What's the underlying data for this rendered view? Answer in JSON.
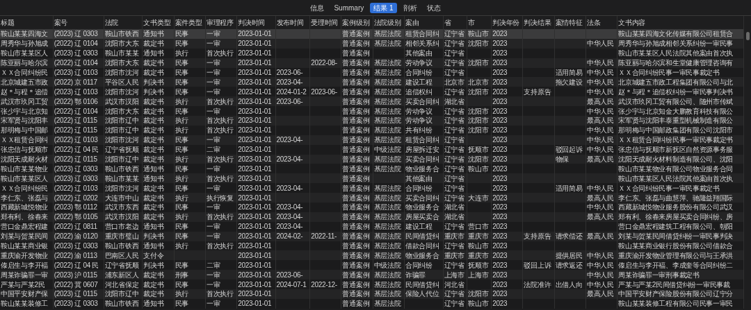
{
  "tabs": [
    {
      "label": "信息",
      "selected": false
    },
    {
      "label": "Summary",
      "selected": false
    },
    {
      "label": "结果 1",
      "selected": true
    },
    {
      "label": "剖析",
      "selected": false
    },
    {
      "label": "状态",
      "selected": false
    }
  ],
  "table": {
    "columns": [
      "标题",
      "案号",
      "法院",
      "文书类型",
      "案件类型",
      "审理程序",
      "判决时间",
      "发布时间",
      "受理时间",
      "案例级别",
      "法院级别",
      "案由",
      "省",
      "市",
      "判决年份",
      "判决结果",
      "案情特征",
      "法条",
      "文书内容"
    ],
    "rows": [
      {
        "selected": true,
        "cells": [
          "鞍山某某四海文",
          "(2023) 辽 0303",
          "鞍山市铁西",
          "通知书",
          "民事",
          "一审",
          "2023-01-01",
          null,
          null,
          "普通案例",
          "基层法院",
          "租赁合同纠",
          "辽宁省",
          "鞍山市",
          "2023",
          null,
          null,
          null,
          "鞍山某某四海文化传媒有限公司租赁合"
        ]
      },
      {
        "selected": false,
        "cells": [
          "周秀华与孙旭成",
          "(2022) 辽 0104",
          "沈阳市大东",
          "裁定书",
          "民事",
          "一审",
          "2023-01-01",
          null,
          null,
          "普通案例",
          "基层法院",
          "相邻关系纠",
          "辽宁省",
          "沈阳市",
          "2023",
          null,
          null,
          "中华人民",
          "周秀华与孙旭成相邻关系纠纷一审民事"
        ]
      },
      {
        "selected": false,
        "cells": [
          "鞍山市某某区人",
          "(2023) 辽 0303",
          "鞍山市某某",
          "通知书",
          "执行",
          "首次执行",
          "2023-01-01",
          null,
          null,
          "普通案例",
          null,
          "其他案由",
          "辽宁省",
          null,
          "2023",
          null,
          null,
          null,
          "鞍山市某某区人民法院其他案由首次执"
        ]
      },
      {
        "selected": false,
        "cells": [
          "陈亚丽与哈尔滨",
          "(2022) 辽 0104",
          "沈阳市大东",
          "裁定书",
          "民事",
          "一审",
          "2023-01-01",
          null,
          "2022-08-",
          "普通案例",
          "基层法院",
          "劳动争议",
          "辽宁省",
          "沈阳市",
          "2023",
          null,
          null,
          "中华人民",
          "陈亚丽与哈尔滨和生堂健康管理咨询有"
        ]
      },
      {
        "selected": false,
        "cells": [
          "ＸＸ合同纠纷民",
          "(2023) 辽 0103",
          "沈阳市沈河",
          "裁定书",
          "民事",
          "一审",
          "2023-01-01",
          "2023-06-",
          null,
          "普通案例",
          "基层法院",
          "合同纠纷",
          "辽宁省",
          null,
          "2023",
          null,
          "适用简易",
          "中华人民",
          "ＸＸ合同纠纷民事一审民事裁定书"
        ]
      },
      {
        "selected": false,
        "cells": [
          "北京城建五市政",
          "(2022) 京 0117",
          "平谷区人民",
          "判决书",
          "民事",
          "一审",
          "2023-01-01",
          "2023-04-",
          null,
          "普通案例",
          "基层法院",
          "建设工程",
          "北京市",
          "北京市",
          "2023",
          null,
          "拖欠建设",
          "中华人民",
          "北京城建五市政工程集团有限公司与北"
        ]
      },
      {
        "selected": false,
        "cells": [
          "赵＊与程＊追偿",
          "(2023) 辽 0103",
          "沈阳市沈河",
          "判决书",
          "民事",
          "一审",
          "2023-01-01",
          "2024-01-2",
          "2023-06-",
          "普通案例",
          "基层法院",
          "追偿权纠",
          "辽宁省",
          "沈阳市",
          "2023",
          "支持原告",
          null,
          "中华人民",
          "赵＊与程＊追偿权纠纷一审民事判决书"
        ]
      },
      {
        "selected": false,
        "cells": [
          "武汉市玖冈工贸",
          "(2022) 鄂 0106",
          "武汉市汉阳",
          "裁定书",
          "执行",
          "首次执行",
          "2023-01-01",
          "2023-06-",
          null,
          "普通案例",
          "基层法院",
          "买卖合同纠",
          "湖北省",
          null,
          "2023",
          null,
          null,
          "最高人民",
          "武汉市玖冈工贸有限公司、随州市传斌"
        ]
      },
      {
        "selected": false,
        "cells": [
          "张少宇与北京知",
          "(2022) 辽 0104",
          "沈阳市大东",
          "裁定书",
          "民事",
          "一审",
          "2023-01-01",
          null,
          null,
          "普通案例",
          "基层法院",
          "劳动争议",
          "辽宁省",
          "沈阳市",
          "2023",
          null,
          null,
          "中华人民",
          "张少宇与北京知金大鹏教育科技有限公"
        ]
      },
      {
        "selected": false,
        "cells": [
          "宋军贤与沈阳丰",
          "(2022) 辽 0115",
          "沈阳市辽中",
          "裁定书",
          "执行",
          "首次执行",
          "2023-01-01",
          null,
          null,
          "普通案例",
          "基层法院",
          "劳动争议",
          "辽宁省",
          "沈阳市",
          "2023",
          null,
          null,
          "最高人民",
          "宋军贤与沈阳丰泰重型机械制造有限公"
        ]
      },
      {
        "selected": false,
        "cells": [
          "那明梅与中国邮",
          "(2022) 辽 0115",
          "沈阳市辽中",
          "裁定书",
          "执行",
          "首次执行",
          "2023-01-01",
          null,
          null,
          "普通案例",
          "基层法院",
          "共有纠纷",
          "辽宁省",
          "沈阳市",
          "2023",
          null,
          null,
          "中华人民",
          "那明梅与中国邮政集团有限公司沈阳市"
        ]
      },
      {
        "selected": false,
        "cells": [
          "ＸＸ租赁合同纠",
          "(2022) 辽 0103",
          "沈阳市沈河",
          "裁定书",
          "民事",
          "一审",
          "2023-01-01",
          "2023-04-",
          null,
          "普通案例",
          "基层法院",
          "租赁合同纠",
          "辽宁省",
          null,
          "2023",
          null,
          null,
          "中华人民",
          "ＸＸ租赁合同纠纷民事一审民事裁定书"
        ]
      },
      {
        "selected": false,
        "cells": [
          "张忠信与抚顺市",
          "(2022) 辽 04 民",
          "辽宁省抚顺",
          "裁定书",
          "民事",
          "二审",
          "2023-01-01",
          null,
          null,
          "普通案例",
          "中级法院",
          "房屋拆迁安",
          "辽宁省",
          "抚顺市",
          "2023",
          null,
          "驳回起诉",
          "中华人民",
          "张忠信与抚顺市新抚区自然资源事务服"
        ]
      },
      {
        "selected": false,
        "cells": [
          "沈阳天成耐火材",
          "(2022) 辽 0115",
          "沈阳市辽中",
          "裁定书",
          "执行",
          "首次执行",
          "2023-01-01",
          "2023-04-",
          null,
          "普通案例",
          "基层法院",
          "买卖合同纠",
          "辽宁省",
          "沈阳市",
          "2023",
          null,
          "物保",
          "最高人民",
          "沈阳天成耐火材料制造有限公司、沈阳"
        ]
      },
      {
        "selected": false,
        "cells": [
          "鞍山市某某物业",
          "(2023) 辽 0303",
          "鞍山市铁西",
          "通知书",
          "民事",
          "一审",
          "2023-01-01",
          null,
          null,
          "普通案例",
          "基层法院",
          "物业服务合",
          "辽宁省",
          "鞍山市",
          "2023",
          null,
          null,
          null,
          "鞍山市某某物业有限公司物业服务合同"
        ]
      },
      {
        "selected": false,
        "cells": [
          "鞍山市某某区人",
          "(2023) 辽 0303",
          "鞍山市某某",
          "通知书",
          "执行",
          "首次执行",
          "2023-01-01",
          null,
          null,
          "普通案例",
          null,
          "其他案由",
          "辽宁省",
          null,
          "2023",
          null,
          null,
          null,
          "鞍山市某某区人民法院其他案由首次执"
        ]
      },
      {
        "selected": false,
        "cells": [
          "ＸＸ合同纠纷民",
          "(2022) 辽 0103",
          "沈阳市沈河",
          "裁定书",
          "民事",
          "一审",
          "2023-01-01",
          "2023-04-",
          null,
          "普通案例",
          "基层法院",
          "合同纠纷",
          "辽宁省",
          null,
          "2023",
          null,
          "适用简易",
          "中华人民",
          "ＸＸ合同纠纷民事一审民事裁定书"
        ]
      },
      {
        "selected": false,
        "cells": [
          "李仁东、张磊与",
          "(2022) 辽 0202",
          "大连市中山",
          "裁定书",
          "执行",
          "执行恢复",
          "2023-01-01",
          null,
          null,
          "普通案例",
          "基层法院",
          "买卖合同纠",
          "辽宁省",
          "大连市",
          "2023",
          null,
          null,
          "最高人民",
          "李仁东、张磊与曲慧萍、驰隆益翔国际"
        ]
      },
      {
        "selected": false,
        "cells": [
          "西藏新城悦物业",
          "(2023) 鄂 0112",
          "武汉市东西",
          "裁定书",
          "民事",
          "一审",
          "2023-01-01",
          "2023-04-",
          null,
          "普通案例",
          "基层法院",
          "物业服务合",
          "湖北省",
          null,
          "2023",
          null,
          null,
          "中华人民",
          "西藏新城悦物业服务股份有限公司武汉"
        ]
      },
      {
        "selected": false,
        "cells": [
          "郑有利、徐春来",
          "(2022) 鄂 0105",
          "武汉市汉阳",
          "裁定书",
          "执行",
          "首次执行",
          "2023-01-01",
          "2023-04-",
          null,
          "普通案例",
          "基层法院",
          "房屋买卖合",
          "湖北省",
          null,
          "2023",
          null,
          null,
          "最高人民",
          "郑有利、徐春来房屋买卖合同纠纷、房"
        ]
      },
      {
        "selected": false,
        "cells": [
          "营口金鼎宏程建",
          "(2022) 辽 0811",
          "营口市老边",
          "通知书",
          "民事",
          "一审",
          "2023-01-01",
          "2023-04-",
          null,
          "普通案例",
          "基层法院",
          "建设工程",
          "辽宁省",
          "营口市",
          "2023",
          null,
          null,
          null,
          "营口金鼎宏程建筑工程有限公司、朝阳"
        ]
      },
      {
        "selected": false,
        "cells": [
          "刘某与贺某民间",
          "(2022) 渝 0120",
          "重庆市璧山",
          "判决书",
          "民事",
          "一审",
          "2023-01-01",
          "2024-02-",
          "2022-11-",
          "普通案例",
          "基层法院",
          "民间借贷纠",
          "重庆市",
          "重庆市",
          "2023",
          "支持原告",
          "请求偿还",
          "最高人民",
          "刘某与贺某民间借贷纠纷一审民事判决"
        ]
      },
      {
        "selected": false,
        "cells": [
          "鞍山某某商业银",
          "(2023) 辽 0303",
          "鞍山市铁西",
          "通知书",
          "执行",
          "首次执行",
          "2023-01-01",
          null,
          null,
          "普通案例",
          "基层法院",
          "借款合同纠",
          "辽宁省",
          "鞍山市",
          "2023",
          null,
          null,
          null,
          "鞍山某某商业银行股份有限公司借款合"
        ]
      },
      {
        "selected": false,
        "cells": [
          "重庆渝开发物业",
          "(2022) 渝 0113",
          "巴南区人民",
          "支付令",
          null,
          null,
          "2023-01-01",
          null,
          null,
          "普通案例",
          "基层法院",
          "物业服务合",
          "重庆市",
          "重庆市",
          "2023",
          null,
          "提供居民",
          "中华人民",
          "重庆渝开发物业管理有限公司与王承洪"
        ]
      },
      {
        "selected": false,
        "cells": [
          "傣启生与李开福",
          "(2022) 辽 04 民",
          "辽宁省抚顺",
          "判决书",
          "民事",
          "二审",
          "2023-01-01",
          null,
          null,
          "普通案例",
          "中级法院",
          "合同纠纷",
          "辽宁省",
          "抚顺市",
          "2023",
          "驳回上诉",
          "请求返还",
          "中华人民",
          "傣启生与李开福、李成奎等合同纠纷二"
        ]
      },
      {
        "selected": false,
        "cells": [
          "周某诈骗罪一审",
          "(2023) 沪 0115",
          "浦东新区人",
          "裁定书",
          "刑事",
          "一审",
          "2023-01-01",
          "2023-06-",
          null,
          "普通案例",
          "基层法院",
          "诈骗罪",
          "上海市",
          "上海市",
          "2023",
          null,
          null,
          "中华人民",
          "周某诈骗罪一审刑事裁定书"
        ]
      },
      {
        "selected": false,
        "cells": [
          "严某与严某2民",
          "(2022) 冀 0607",
          "河北省保定",
          "裁定书",
          "民事",
          "一审",
          "2023-01-01",
          "2024-07-1",
          "2022-12-",
          "普通案例",
          "基层法院",
          "民间借贷纠",
          "河北省",
          null,
          "2023",
          "法院准许",
          "出借人向",
          "中华人民",
          "严某与严某2民间借贷纠纷一审民事裁"
        ]
      },
      {
        "selected": false,
        "cells": [
          "中国平安财产保",
          "(2023) 辽 0115",
          "沈阳市辽中",
          "裁定书",
          "执行",
          "首次执行",
          "2023-01-01",
          null,
          null,
          "普通案例",
          "基层法院",
          "保险人代位",
          "辽宁省",
          "沈阳市",
          "2023",
          null,
          null,
          "最高人民",
          "中国平安财产保险股份有限公司辽宁分"
        ]
      },
      {
        "selected": false,
        "cells": [
          "鞍山某某装修工",
          "(2023) 辽 0303",
          "鞍山市铁西",
          "通知书",
          "民事",
          "一审",
          "2023-01-01",
          null,
          null,
          "普通案例",
          "基层法院",
          null,
          "辽宁省",
          "鞍山市",
          "2023",
          null,
          null,
          null,
          "鞍山某某装修工程有限公司民事一审民"
        ]
      }
    ]
  }
}
